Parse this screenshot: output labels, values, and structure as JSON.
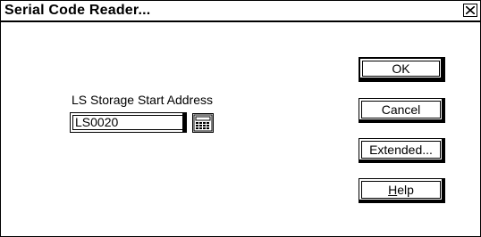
{
  "window": {
    "title": "Serial Code Reader..."
  },
  "form": {
    "address_label": "LS Storage Start Address",
    "address_value": "LS0020"
  },
  "buttons": {
    "ok": "OK",
    "cancel": "Cancel",
    "extended": "Extended...",
    "help_mnemonic": "H",
    "help_rest": "elp"
  },
  "icons": {
    "close": "close-icon",
    "keypad": "keypad-icon"
  }
}
